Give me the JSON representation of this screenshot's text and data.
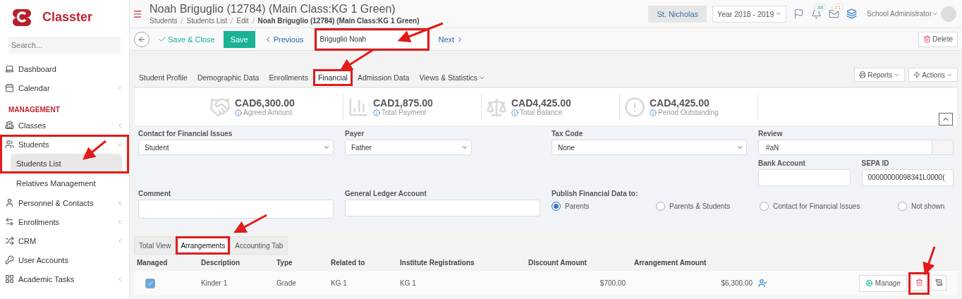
{
  "sidebar": {
    "logo": "Classter",
    "search": {
      "placeholder": "Search..."
    },
    "items": [
      {
        "kind": "link",
        "label": "Dashboard",
        "chevron": false
      },
      {
        "kind": "link",
        "label": "Calendar",
        "chevron": true
      },
      {
        "kind": "section",
        "label": "MANAGEMENT"
      },
      {
        "kind": "link",
        "label": "Classes",
        "chevron": true
      },
      {
        "kind": "group",
        "label": "Students",
        "expanded": true,
        "children": [
          {
            "label": "Students List",
            "selected": true
          },
          {
            "label": "Relatives Management",
            "selected": false
          }
        ]
      },
      {
        "kind": "link",
        "label": "Personnel & Contacts",
        "chevron": true
      },
      {
        "kind": "link",
        "label": "Enrollments",
        "chevron": true
      },
      {
        "kind": "link",
        "label": "CRM",
        "chevron": true
      },
      {
        "kind": "link",
        "label": "User Accounts",
        "chevron": false
      },
      {
        "kind": "link",
        "label": "Academic Tasks",
        "chevron": true
      }
    ]
  },
  "header": {
    "title": "Noah Briguglio (12784) (Main Class:KG 1 Green)",
    "breadcrumbs": [
      {
        "label": "Students",
        "current": false
      },
      {
        "label": "Students List",
        "current": false
      },
      {
        "label": "Edit",
        "current": false
      },
      {
        "label": "Noah Briguglio (12784) (Main Class:KG 1 Green)",
        "current": true
      }
    ],
    "school": "St. Nicholas",
    "year": "Year 2018 - 2019",
    "notifications": "38",
    "messages": "21",
    "user": "School Administrator"
  },
  "toolbar": {
    "save_close": "Save & Close",
    "save": "Save",
    "previous": "Previous",
    "student_search": "Briguglio Noah",
    "next": "Next",
    "delete": "Delete"
  },
  "tabs": [
    {
      "label": "Student Profile",
      "selected": false
    },
    {
      "label": "Demographic Data",
      "selected": false
    },
    {
      "label": "Enrollments",
      "selected": false
    },
    {
      "label": "Financial",
      "selected": true
    },
    {
      "label": "Admission Data",
      "selected": false
    },
    {
      "label": "Views & Statistics",
      "selected": false
    }
  ],
  "tab_buttons": {
    "reports": "Reports",
    "actions": "Actions"
  },
  "summary": [
    {
      "amount": "CAD6,300.00",
      "label": "Agreed Amount"
    },
    {
      "amount": "CAD1,875.00",
      "label": "Total Payment"
    },
    {
      "amount": "CAD4,425.00",
      "label": "Total Balance"
    },
    {
      "amount": "CAD4,425.00",
      "label": "Period Outstanding"
    }
  ],
  "form": {
    "contact": {
      "label": "Contact for Financial Issues",
      "value": "Student"
    },
    "payer": {
      "label": "Payer",
      "value": "Father"
    },
    "tax_code": {
      "label": "Tax Code",
      "value": "None"
    },
    "review": {
      "label": "Review",
      "value": "#aN"
    },
    "bank_account": {
      "label": "Bank Account"
    },
    "sepa_id": {
      "label": "SEPA ID",
      "value": "00000000098341L0000("
    },
    "comment": {
      "label": "Comment"
    },
    "ledger": {
      "label": "General Ledger Account"
    },
    "publish": {
      "label": "Publish Financial Data to:",
      "options": [
        {
          "label": "Parents",
          "selected": true
        },
        {
          "label": "Parents & Students",
          "selected": false
        },
        {
          "label": "Contact for Financial Issues",
          "selected": false
        },
        {
          "label": "Not shown",
          "selected": false
        }
      ]
    }
  },
  "subtabs": [
    {
      "label": "Total View",
      "selected": false
    },
    {
      "label": "Arrangements",
      "selected": true
    },
    {
      "label": "Accounting Tab",
      "selected": false
    }
  ],
  "table": {
    "columns": [
      "Managed",
      "Description",
      "Type",
      "Related to",
      "Institute Registrations",
      "Discount Amount",
      "Arrangement Amount"
    ],
    "rows": [
      {
        "managed": true,
        "description": "Kinder 1",
        "type": "Grade",
        "related_to": "KG 1",
        "institute_registrations": "KG 1",
        "discount_amount": "$700.00",
        "arrangement_amount": "$6,300.00",
        "manage": "Manage"
      }
    ]
  }
}
